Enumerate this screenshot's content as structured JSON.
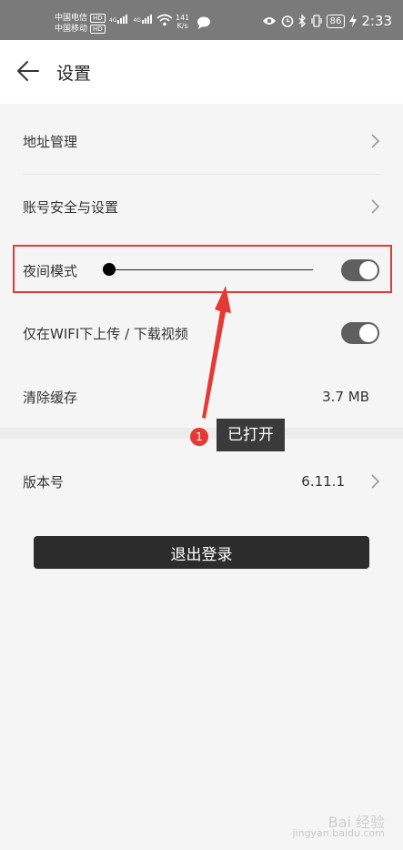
{
  "status_bar": {
    "carrier_1": "中国电信",
    "carrier_2": "中国移动",
    "hd": "HD",
    "signal_label_1": "4G",
    "signal_label_2": "4G",
    "speed_value": "141",
    "speed_unit": "K/s",
    "battery": "86",
    "time": "2:33"
  },
  "header": {
    "title": "设置"
  },
  "settings": {
    "address": {
      "label": "地址管理"
    },
    "account": {
      "label": "账号安全与设置"
    },
    "night_mode": {
      "label": "夜间模式",
      "enabled": true
    },
    "wifi_upload": {
      "label": "仅在WIFI下上传 / 下载视频",
      "enabled": true
    },
    "cache": {
      "label": "清除缓存",
      "value": "3.7 MB"
    },
    "version": {
      "label": "版本号",
      "value": "6.11.1"
    }
  },
  "annotation": {
    "number": "1",
    "text": "已打开"
  },
  "logout": {
    "label": "退出登录"
  },
  "watermark": {
    "main": "Bai 经验",
    "sub": "jingyan.baidu.com"
  },
  "colors": {
    "status_bar": "#7a7a7a",
    "toggle_on": "#5f5f5f",
    "highlight": "#e53935",
    "button": "#2c2c2c"
  }
}
